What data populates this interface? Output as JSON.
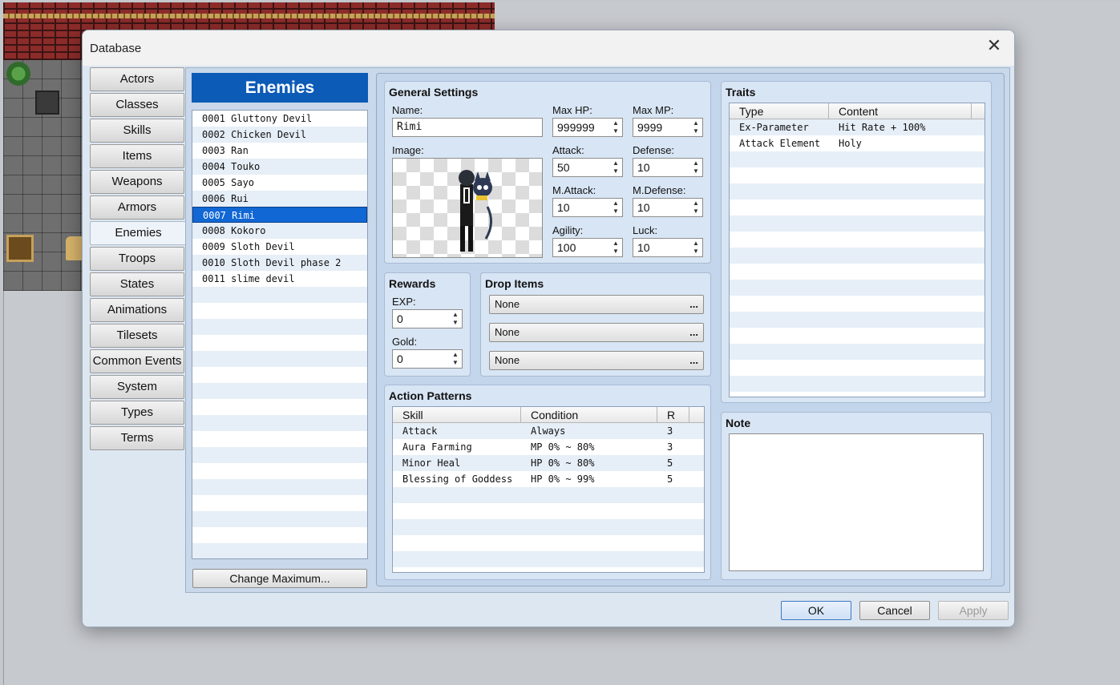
{
  "window": {
    "title": "Database"
  },
  "categories": [
    "Actors",
    "Classes",
    "Skills",
    "Items",
    "Weapons",
    "Armors",
    "Enemies",
    "Troops",
    "States",
    "Animations",
    "Tilesets",
    "Common Events",
    "System",
    "Types",
    "Terms"
  ],
  "active_category": "Enemies",
  "enemy_list": {
    "title": "Enemies",
    "items": [
      "0001 Gluttony Devil",
      "0002 Chicken Devil",
      "0003 Ran",
      "0004 Touko",
      "0005 Sayo",
      "0006 Rui",
      "0007 Rimi",
      "0008 Kokoro",
      "0009 Sloth Devil",
      "0010 Sloth Devil phase 2",
      "0011 slime devil"
    ],
    "selected": "0007 Rimi",
    "change_max_label": "Change Maximum..."
  },
  "general": {
    "title": "General Settings",
    "name_label": "Name:",
    "name_value": "Rimi",
    "image_label": "Image:",
    "max_hp_label": "Max HP:",
    "max_hp": "999999",
    "max_mp_label": "Max MP:",
    "max_mp": "9999",
    "attack_label": "Attack:",
    "attack": "50",
    "defense_label": "Defense:",
    "defense": "10",
    "mattack_label": "M.Attack:",
    "mattack": "10",
    "mdefense_label": "M.Defense:",
    "mdefense": "10",
    "agility_label": "Agility:",
    "agility": "100",
    "luck_label": "Luck:",
    "luck": "10"
  },
  "rewards": {
    "title": "Rewards",
    "exp_label": "EXP:",
    "exp": "0",
    "gold_label": "Gold:",
    "gold": "0"
  },
  "drops": {
    "title": "Drop Items",
    "items": [
      "None",
      "None",
      "None"
    ],
    "more": "..."
  },
  "actions": {
    "title": "Action Patterns",
    "columns": [
      "Skill",
      "Condition",
      "R"
    ],
    "rows": [
      [
        "Attack",
        "Always",
        "3"
      ],
      [
        "Aura Farming",
        "MP 0% ~ 80%",
        "3"
      ],
      [
        "Minor Heal",
        "HP 0% ~ 80%",
        "5"
      ],
      [
        "Blessing of Goddess",
        "HP 0% ~ 99%",
        "5"
      ]
    ]
  },
  "traits": {
    "title": "Traits",
    "columns": [
      "Type",
      "Content"
    ],
    "rows": [
      [
        "Ex-Parameter",
        "Hit Rate + 100%"
      ],
      [
        "Attack Element",
        "Holy"
      ]
    ]
  },
  "note": {
    "title": "Note"
  },
  "footer": {
    "ok": "OK",
    "cancel": "Cancel",
    "apply": "Apply"
  },
  "colors": {
    "accent": "#0c5bb7",
    "selection": "#1167d4",
    "panel": "#d8e5f4"
  }
}
